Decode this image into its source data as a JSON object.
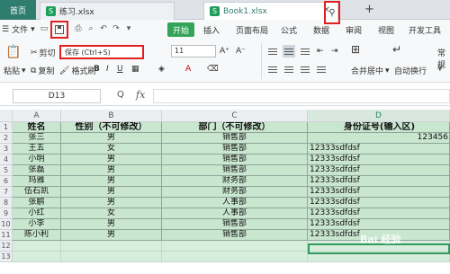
{
  "tabs": {
    "home": "首页",
    "file1": "练习.xlsx",
    "file2": "Book1.xlsx",
    "add": "+",
    "xlogo": "S"
  },
  "ribbon": {
    "file_menu": "文件",
    "start": "开始",
    "menus": [
      "插入",
      "页面布局",
      "公式",
      "数据",
      "审阅",
      "视图",
      "开发工具"
    ],
    "cut": "剪切",
    "paste": "粘贴",
    "copy": "复制",
    "format_painter": "格式刷",
    "save_tooltip": "保存 (Ctrl+S)",
    "font_size": "11",
    "merge_center": "合并居中",
    "auto_wrap": "自动换行",
    "normal": "常规"
  },
  "formula_bar": {
    "cell_ref": "D13",
    "fx_label": "fx",
    "zoom_icon": "Q"
  },
  "sheet": {
    "columns": [
      "A",
      "B",
      "C",
      "D"
    ],
    "rows": [
      "1",
      "2",
      "3",
      "4",
      "5",
      "6",
      "7",
      "8",
      "9",
      "10",
      "11",
      "12",
      "13"
    ],
    "header": [
      "姓名",
      "性别（不可修改）",
      "部门（不可修改）",
      "身份证号(输入区)"
    ],
    "data": [
      [
        "张三",
        "男",
        "销售部",
        "123456"
      ],
      [
        "王五",
        "女",
        "销售部",
        "12333sdfdsf"
      ],
      [
        "小明",
        "男",
        "销售部",
        "12333sdfdsf"
      ],
      [
        "张磊",
        "男",
        "销售部",
        "12333sdfdsf"
      ],
      [
        "玛雅",
        "男",
        "财务部",
        "12333sdfdsf"
      ],
      [
        "伍石凯",
        "男",
        "财务部",
        "12333sdfdsf"
      ],
      [
        "张鹏",
        "男",
        "人事部",
        "12333sdfdsf"
      ],
      [
        "小红",
        "女",
        "人事部",
        "12333sdfdsf"
      ],
      [
        "小李",
        "男",
        "销售部",
        "12333sdfdsf"
      ],
      [
        "陈小利",
        "男",
        "销售部",
        "12333sdfdsf"
      ]
    ],
    "watermark": "Bai 经验"
  }
}
